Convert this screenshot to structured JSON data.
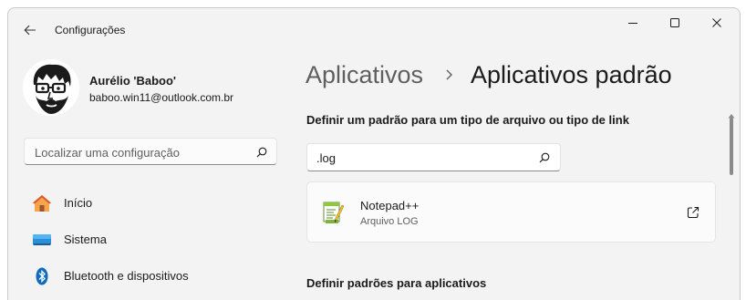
{
  "window": {
    "title": "Configurações"
  },
  "user": {
    "name": "Aurélio 'Baboo'",
    "email": "baboo.win11@outlook.com.br"
  },
  "sidebar": {
    "search_placeholder": "Localizar uma configuração",
    "items": [
      {
        "label": "Início",
        "icon": "home-icon"
      },
      {
        "label": "Sistema",
        "icon": "system-display-icon"
      },
      {
        "label": "Bluetooth e dispositivos",
        "icon": "bluetooth-icon"
      }
    ]
  },
  "main": {
    "breadcrumb": {
      "parent": "Aplicativos",
      "separator": "›",
      "current": "Aplicativos padrão"
    },
    "section1_heading": "Definir um padrão para um tipo de arquivo ou tipo de link",
    "search_value": ".log",
    "result": {
      "app_name": "Notepad++",
      "description": "Arquivo LOG",
      "icon": "notepadplusplus-icon"
    },
    "section2_heading": "Definir padrões para aplicativos"
  },
  "colors": {
    "window_bg": "#f3f3f3",
    "card_bg": "#fbfbfb",
    "secondary_text": "#5f5f5f",
    "accent_blue": "#0067c0"
  }
}
